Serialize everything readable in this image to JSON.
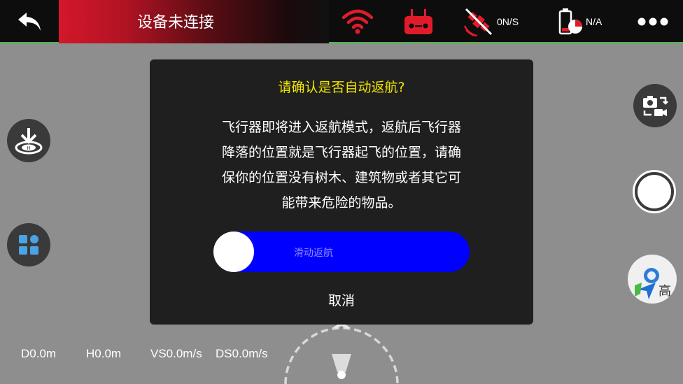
{
  "status": {
    "title": "设备未连接"
  },
  "topbar": {
    "gps_value": "0N/S",
    "battery_value": "N/A"
  },
  "telemetry": {
    "distance": "D0.0m",
    "height": "H0.0m",
    "vertical_speed": "VS0.0m/s",
    "horizontal_speed": "DS0.0m/s"
  },
  "map": {
    "label": "高"
  },
  "dialog": {
    "title": "请确认是否自动返航?",
    "body_lines": [
      "飞行器即将进入返航模式，返航后飞行器",
      "降落的位置就是飞行器起飞的位置，请确",
      "保你的位置没有树木、建筑物或者其它可",
      "能带来危险的物品。"
    ],
    "slider_label": "滑动返航",
    "cancel_label": "取消"
  },
  "colors": {
    "alert_red": "#d4172a",
    "dialog_title": "#f2e600",
    "slider_blue": "#0000ff",
    "topbar_border": "#4cb848"
  },
  "icons": [
    "back-arrow-icon",
    "wifi-icon",
    "remote-controller-icon",
    "satellite-icon",
    "battery-icon",
    "more-icon",
    "return-home-icon",
    "grid-icon",
    "camera-switch-icon",
    "map-icon",
    "compass-icon"
  ]
}
